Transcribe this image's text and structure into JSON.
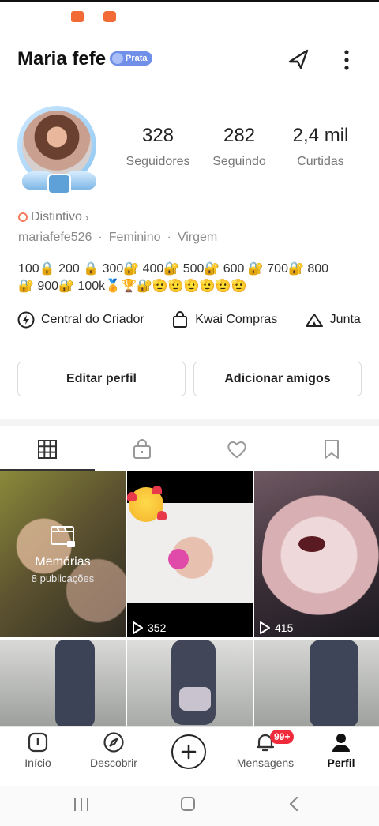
{
  "status_bar": {
    "icons": [
      "video-icon",
      "app-icon"
    ],
    "icon_color": "#f26a36"
  },
  "header": {
    "name": "Maria fefe",
    "badge_label": "Prata",
    "badge_color": "#6f8fe8"
  },
  "stats": [
    {
      "value": "328",
      "label": "Seguidores"
    },
    {
      "value": "282",
      "label": "Seguindo"
    },
    {
      "value": "2,4 mil",
      "label": "Curtidas"
    }
  ],
  "profile": {
    "distintivo": "Distintivo",
    "username": "mariafefe526",
    "gender": "Feminino",
    "sign": "Virgem",
    "bio_line1": "100🔒 200 🔒 300🔐 400🔐 500🔐 600 🔐 700🔐 800",
    "bio_line2": "🔐 900🔐 100k🏅🏆🔐🫡🫡🫡🫡🫡🫡"
  },
  "links": [
    {
      "label": "Central do Criador",
      "icon": "lightning-icon"
    },
    {
      "label": "Kwai Compras",
      "icon": "bag-icon"
    },
    {
      "label": "Junta",
      "icon": "tent-icon"
    }
  ],
  "buttons": {
    "edit": "Editar perfil",
    "add_friends": "Adicionar amigos"
  },
  "tabs": [
    "grid-icon",
    "lock-icon",
    "heart-icon",
    "bookmark-icon"
  ],
  "grid": {
    "memories_title": "Memórias",
    "memories_sub": "8 publicações",
    "plays": [
      "352",
      "415"
    ]
  },
  "bottom_nav": {
    "items": [
      "Início",
      "Descobrir",
      "Mensagens",
      "Perfil"
    ],
    "notification_badge": "99+",
    "badge_color": "#ef2b3c"
  }
}
